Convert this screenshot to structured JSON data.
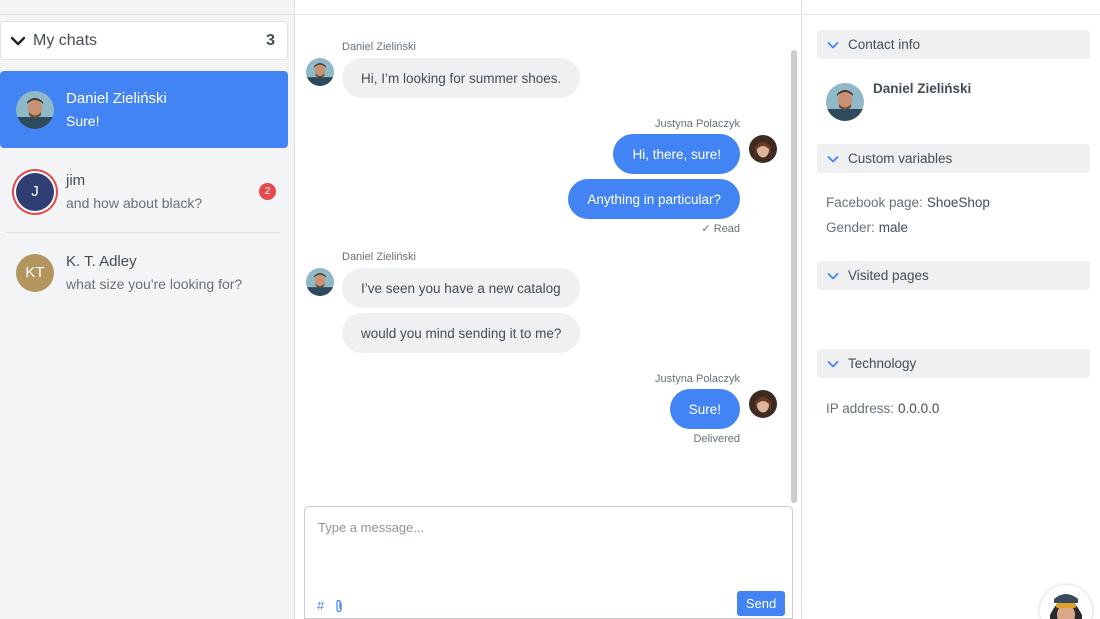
{
  "sidebar": {
    "my_chats_label": "My chats",
    "my_chats_count": "3",
    "chats": [
      {
        "name": "Daniel Zieliński",
        "preview": "Sure!",
        "active": true,
        "avatar": "photo"
      },
      {
        "name": "jim",
        "preview": "and how about black?",
        "avatar_initials": "J",
        "unread": "2"
      },
      {
        "name": "K. T. Adley",
        "preview": "what size you're looking for?",
        "avatar_initials": "KT"
      }
    ]
  },
  "chat": {
    "messages": [
      {
        "author": "Daniel Zieliński",
        "direction": "in",
        "texts": [
          "Hi, I’m looking for summer shoes."
        ]
      },
      {
        "author": "Justyna Polaczyk",
        "direction": "out",
        "texts": [
          "Hi, there, sure!",
          "Anything in particular?"
        ],
        "status": "Read"
      },
      {
        "author": "Daniel Zieliński",
        "direction": "in",
        "texts": [
          "I’ve seen you have a new catalog",
          "would you mind sending it to me?"
        ]
      },
      {
        "author": "Justyna Polaczyk",
        "direction": "out",
        "texts": [
          "Sure!"
        ],
        "status": "Delivered"
      }
    ],
    "composer": {
      "placeholder": "Type a message...",
      "hash_icon": "#",
      "send_label": "Send"
    }
  },
  "panel": {
    "contact_info": {
      "title": "Contact info",
      "name": "Daniel Zieliński"
    },
    "custom_variables": {
      "title": "Custom variables",
      "items": [
        {
          "key": "Facebook page:",
          "value": "ShoeShop"
        },
        {
          "key": "Gender:",
          "value": "male"
        }
      ]
    },
    "visited_pages": {
      "title": "Visited pages"
    },
    "technology": {
      "title": "Technology",
      "items": [
        {
          "key": "IP address:",
          "value": "0.0.0.0"
        }
      ]
    }
  },
  "colors": {
    "accent": "#4384f5",
    "badge": "#e5484d",
    "bubble_in": "#eef0f2"
  }
}
